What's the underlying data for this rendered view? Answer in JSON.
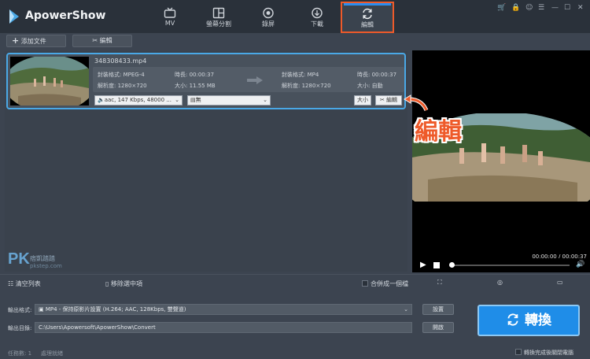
{
  "app": {
    "name": "ApowerShow"
  },
  "nav": [
    {
      "label": "MV",
      "icon": "tv-icon"
    },
    {
      "label": "螢幕分割",
      "icon": "split-screen-icon"
    },
    {
      "label": "錄屏",
      "icon": "record-icon"
    },
    {
      "label": "下載",
      "icon": "download-icon"
    },
    {
      "label": "編輯",
      "icon": "refresh-icon",
      "active": true
    }
  ],
  "toolbar": {
    "add_file": "添加文件",
    "edit": "編輯"
  },
  "file": {
    "name": "348308433.mp4",
    "source": {
      "format_label": "封裝格式: MPEG-4",
      "duration_label": "時長: 00:00:37",
      "resolution_label": "解析度: 1280×720",
      "size_label": "大小: 11.55 MB"
    },
    "target": {
      "format_label": "封裝格式: MP4",
      "duration_label": "時長: 00:00:37",
      "resolution_label": "解析度: 1280×720",
      "size_label": "大小: 自動"
    },
    "audio_track": "aac, 147 Kbps, 48000 ...",
    "subtitle": "無",
    "size_button": "大小",
    "edit_button": "編輯"
  },
  "preview": {
    "timecode": "00:00:00 / 00:00:37",
    "progress": 0
  },
  "annotation": "編輯",
  "watermark": {
    "logo": "PK",
    "text": "痞凱踏踏",
    "url": "pkstep.com"
  },
  "actions": {
    "clear_list": "清空列表",
    "remove_selected": "移除選中項",
    "merge": "合併成一個檔"
  },
  "output": {
    "format_label": "輸出格式:",
    "format_value": "MP4 - 保持原影片設置 (H.264; AAC, 128Kbps, 雙聲道)",
    "dir_label": "輸出目錄:",
    "dir_value": "C:\\Users\\Apowersoft\\ApowerShow\\Convert",
    "settings_button": "設置",
    "open_button": "開啟",
    "convert_button": "轉換"
  },
  "status": {
    "tasks": "任務數: 1",
    "state": "處理就緒",
    "shutdown": "轉換完成後關閉電腦"
  },
  "colors": {
    "accent": "#1f8de8",
    "highlight": "#ee5a2a",
    "titlebar": "#2a313a",
    "panel": "#3c4450"
  }
}
